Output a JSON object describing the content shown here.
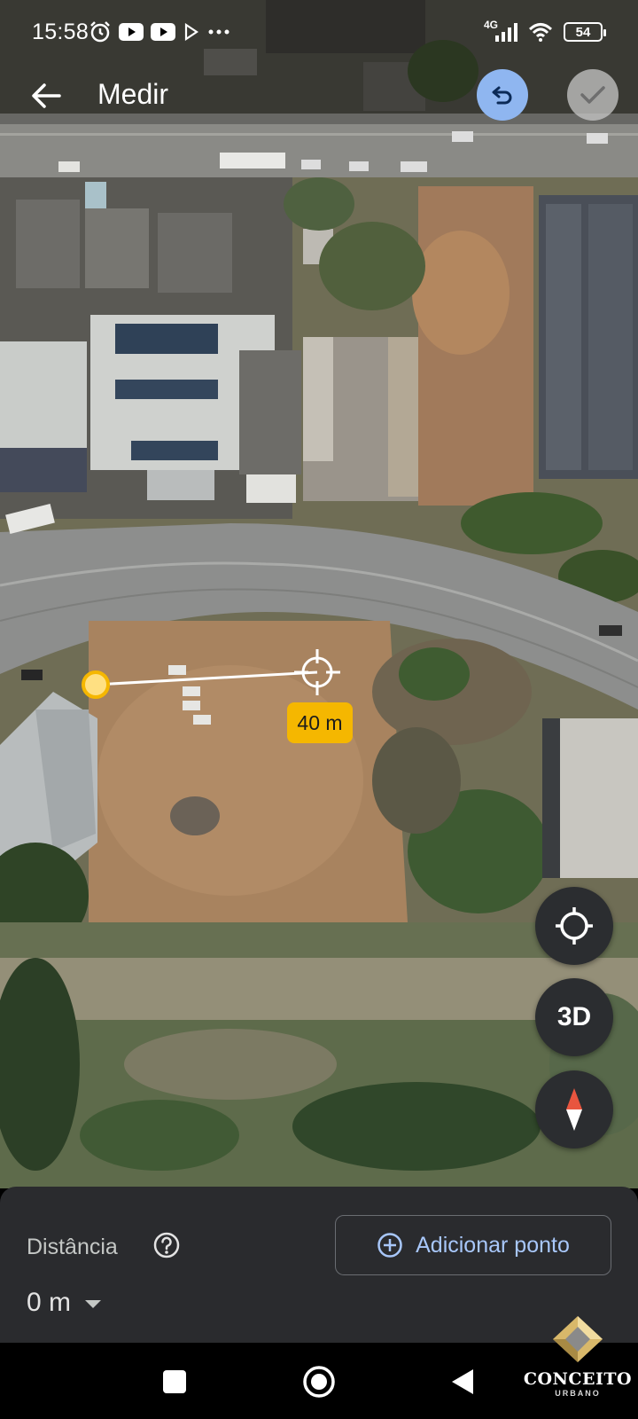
{
  "status_bar": {
    "time": "15:58",
    "network": "4G",
    "battery": "54"
  },
  "app_bar": {
    "title": "Medir",
    "back_icon": "arrow-back-icon",
    "undo_icon": "undo-icon",
    "confirm_icon": "check-icon"
  },
  "measurement": {
    "segment_label": "40 m"
  },
  "map_controls": {
    "location_icon": "my-location-icon",
    "view_3d_label": "3D",
    "compass_icon": "compass-icon"
  },
  "bottom_panel": {
    "distance_label": "Distância",
    "add_point_label": "Adicionar ponto",
    "distance_value": "0 m"
  },
  "watermark": {
    "name": "CONCEITO",
    "subtitle": "URBANO"
  },
  "colors": {
    "accent": "#a8c7fa",
    "undo_bg": "#8fb6f0",
    "label_bg": "#f5b700",
    "panel_bg": "#2a2b2e"
  }
}
